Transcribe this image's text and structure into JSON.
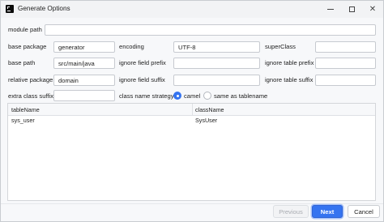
{
  "window": {
    "title": "Generate Options",
    "minimize_glyph": "–",
    "maximize_glyph": "□",
    "close_glyph": "✕"
  },
  "form": {
    "module_path": {
      "label": "module path",
      "value": ""
    },
    "base_package": {
      "label": "base package",
      "value": "generator"
    },
    "encoding": {
      "label": "encoding",
      "value": "UTF-8"
    },
    "super_class": {
      "label": "superClass",
      "value": ""
    },
    "base_path": {
      "label": "base path",
      "value": "src/main/java"
    },
    "ignore_field_prefix": {
      "label": "ignore field prefix",
      "value": ""
    },
    "ignore_table_prefix": {
      "label": "ignore table prefix",
      "value": ""
    },
    "relative_package": {
      "label": "relative package",
      "value": "domain"
    },
    "ignore_field_suffix": {
      "label": "ignore field suffix",
      "value": ""
    },
    "ignore_table_suffix": {
      "label": "ignore table suffix",
      "value": ""
    },
    "extra_class_suffix": {
      "label": "extra class suffix",
      "value": ""
    },
    "class_name_strategy": {
      "label": "class name strategy",
      "options": [
        {
          "label": "camel",
          "selected": true
        },
        {
          "label": "same as tablename",
          "selected": false
        }
      ]
    }
  },
  "table": {
    "columns": [
      "tableName",
      "className"
    ],
    "rows": [
      {
        "tableName": "sys_user",
        "className": "SysUser"
      }
    ]
  },
  "footer": {
    "previous_label": "Previous",
    "next_label": "Next",
    "cancel_label": "Cancel"
  },
  "colors": {
    "accent": "#3574f0",
    "window_bg": "#f7f8fa",
    "border": "#c7cad0"
  }
}
